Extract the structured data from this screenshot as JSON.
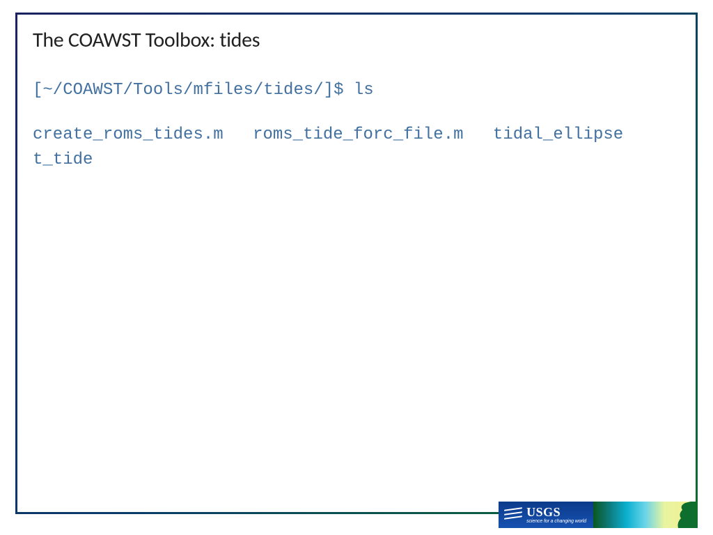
{
  "slide": {
    "title": "The COAWST Toolbox: tides"
  },
  "terminal": {
    "prompt": "[~/COAWST/Tools/mfiles/tides/]$ ls",
    "output": [
      "create_roms_tides.m",
      "roms_tide_forc_file.m",
      "tidal_ellipse",
      "t_tide"
    ]
  },
  "footer": {
    "logo_main": "USGS",
    "logo_sub": "science for a changing world"
  }
}
